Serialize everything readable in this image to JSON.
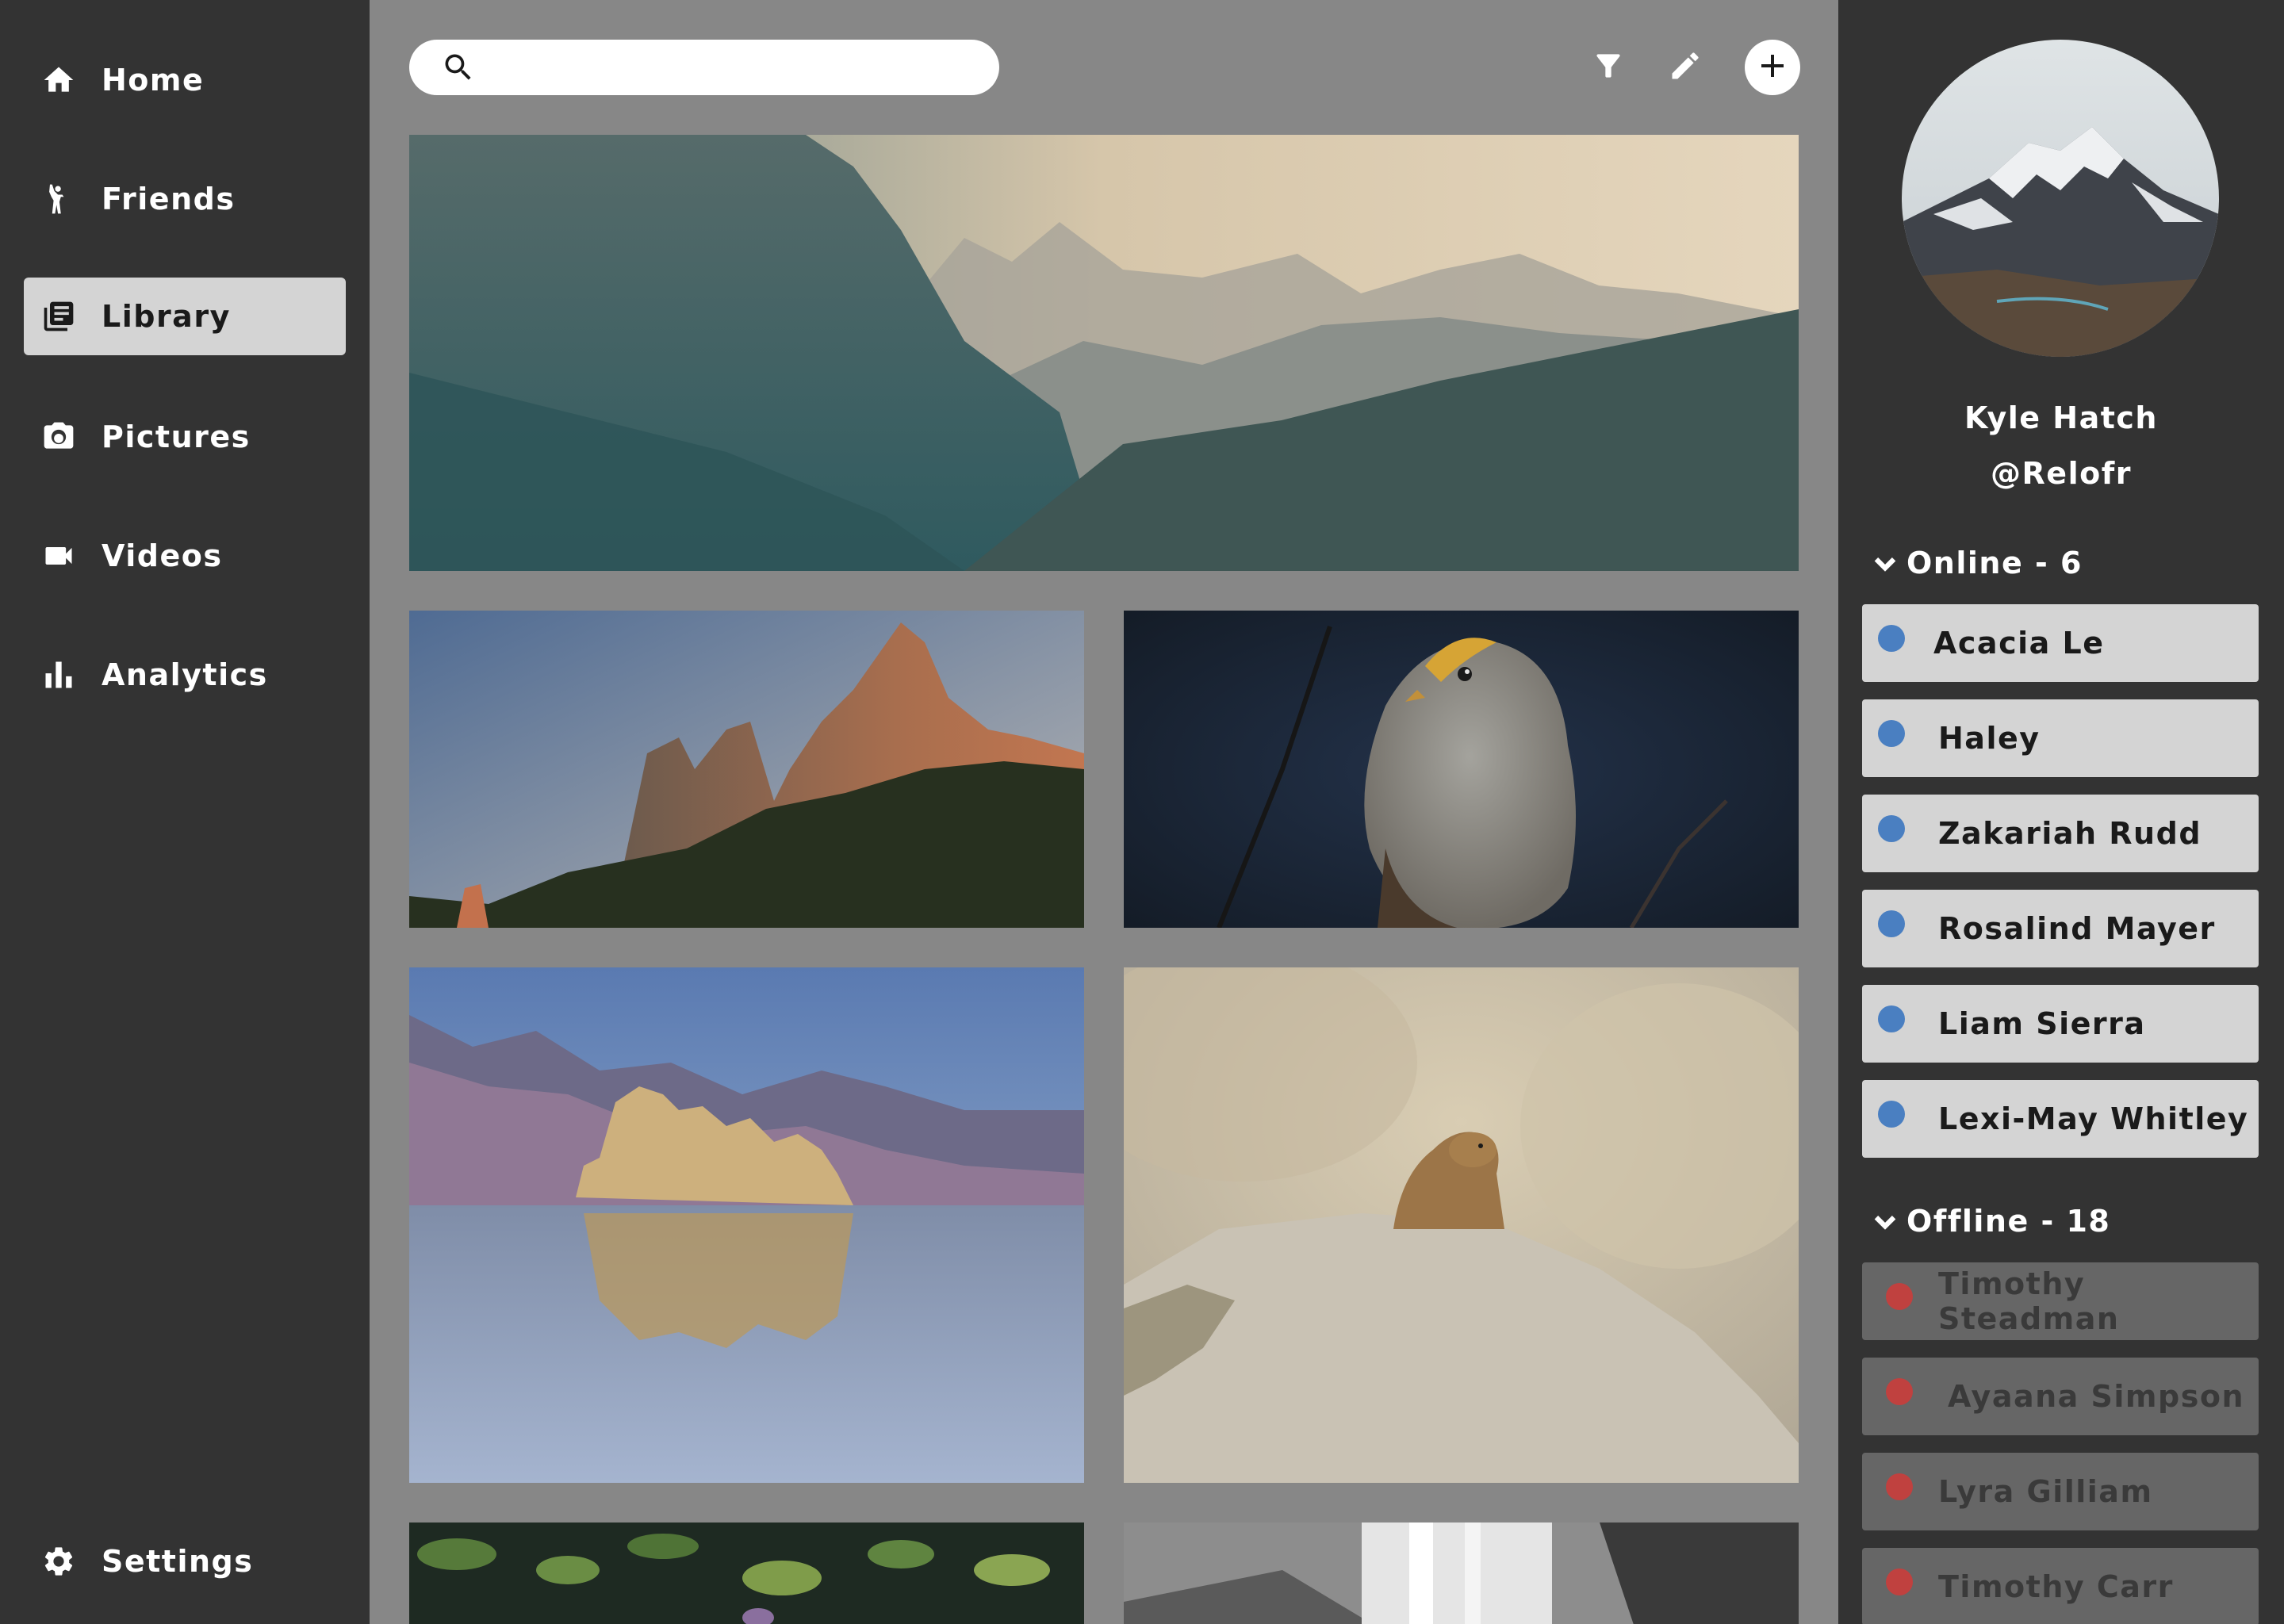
{
  "sidebar": {
    "items": [
      {
        "label": "Home",
        "icon": "home-icon"
      },
      {
        "label": "Friends",
        "icon": "person-wave-icon"
      },
      {
        "label": "Library",
        "icon": "library-icon",
        "active": true
      },
      {
        "label": "Pictures",
        "icon": "camera-icon"
      },
      {
        "label": "Videos",
        "icon": "video-camera-icon"
      },
      {
        "label": "Analytics",
        "icon": "bar-chart-icon"
      }
    ],
    "settings": {
      "label": "Settings",
      "icon": "gear-icon"
    }
  },
  "toolbar": {
    "search_value": "",
    "search_icon": "search-icon",
    "filter_icon": "filter-icon",
    "edit_icon": "pencil-icon",
    "add_icon": "plus-icon"
  },
  "gallery": {
    "photos": [
      {
        "subject": "misty mountain valley",
        "icon": "landscape-photo"
      },
      {
        "subject": "rocky peaks at sunset",
        "icon": "landscape-photo"
      },
      {
        "subject": "sparrow on branch",
        "icon": "bird-photo"
      },
      {
        "subject": "tufa towers on lake",
        "icon": "landscape-photo"
      },
      {
        "subject": "marmot on rock",
        "icon": "animal-photo"
      },
      {
        "subject": "green leaves",
        "icon": "plant-photo"
      },
      {
        "subject": "waterfall",
        "icon": "waterfall-photo"
      }
    ]
  },
  "profile": {
    "name": "Kyle Hatch",
    "handle": "@Relofr"
  },
  "friends": {
    "online_header": "Online - 6",
    "offline_header": "Offline - 18",
    "online_color": "#4a7fc1",
    "offline_color": "#c0413f",
    "online": [
      "Acacia Le",
      "Haley",
      "Zakariah Rudd",
      "Rosalind Mayer",
      "Liam Sierra",
      "Lexi-May Whitley"
    ],
    "offline": [
      "Timothy Steadman",
      "Ayaana Simpson",
      "Lyra Gilliam",
      "Timothy Carr"
    ]
  },
  "colors": {
    "sidebar_bg": "#333333",
    "main_bg": "#878787",
    "active_item_bg": "#d4d4d4"
  }
}
